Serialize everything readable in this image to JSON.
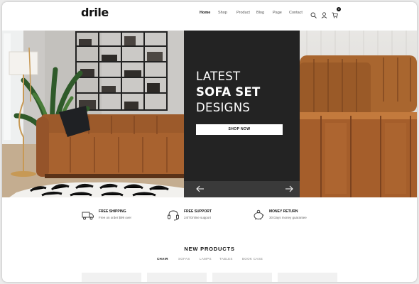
{
  "brand": {
    "logo_text": "drile"
  },
  "nav": {
    "items": [
      {
        "label": "Home",
        "active": true
      },
      {
        "label": "Shop"
      },
      {
        "label": "Product"
      },
      {
        "label": "Blog"
      },
      {
        "label": "Page"
      },
      {
        "label": "Contact"
      }
    ],
    "icons": [
      "search-icon",
      "user-icon",
      "cart-icon"
    ],
    "cart_count": "0"
  },
  "hero": {
    "line1": "LATEST",
    "line2": "SOFA SET",
    "line3": "DESIGNS",
    "button_label": "SHOP NOW",
    "prev_icon": "arrow-left-icon",
    "next_icon": "arrow-right-icon"
  },
  "features": [
    {
      "icon": "truck-icon",
      "title": "FREE SHIPPING",
      "subtitle": "Free on order $99 over"
    },
    {
      "icon": "headset-icon",
      "title": "FREE SUPPORT",
      "subtitle": "24/7Online support"
    },
    {
      "icon": "piggy-bank-icon",
      "title": "MONEY RETURN",
      "subtitle": "30 Days money guarantee"
    }
  ],
  "products": {
    "title": "NEW PRODUCTS",
    "tabs": [
      {
        "label": "CHAIR",
        "active": true
      },
      {
        "label": "SOFAS"
      },
      {
        "label": "LAMPS"
      },
      {
        "label": "TABLES"
      },
      {
        "label": "BOOK CASE"
      }
    ]
  },
  "colors": {
    "panel": "#232323",
    "slider_bar": "#3a3a3a",
    "leather": "#a8622f"
  }
}
